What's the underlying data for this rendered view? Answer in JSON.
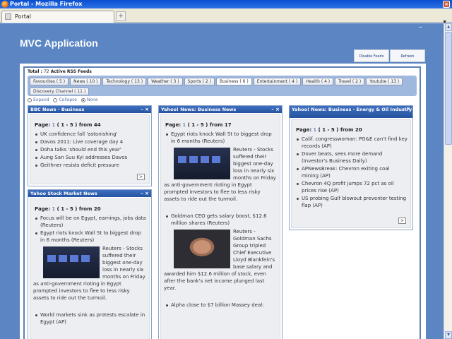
{
  "window": {
    "title": "Portal - Mozilla Firefox",
    "close": "×"
  },
  "browser": {
    "tab_title": "Portal",
    "newtab": "+",
    "scroll_arrow": "▼"
  },
  "app": {
    "title": "MVC Application",
    "dash": "–"
  },
  "actions": {
    "disable_feeds": "Disable Feeds",
    "refresh": "Refresh"
  },
  "total": {
    "label": "Total :",
    "count": "72",
    "suffix": "Active RSS Feeds"
  },
  "categories": [
    "Favourites ( 5 )",
    "News ( 10 )",
    "Technology ( 13 )",
    "Weather ( 3 )",
    "Sports ( 2 )",
    "Business ( 6 )",
    "Entertainment ( 4 )",
    "Health ( 4 )",
    "Travel ( 2 )",
    "Youtube ( 13 )",
    "Discovery Channel ( 11 )"
  ],
  "active_category_index": 5,
  "view_options": {
    "expand": "Expand",
    "collapse": "Collapse",
    "none": "None",
    "selected": "None"
  },
  "widgets": {
    "bbc": {
      "title": "BBC News - Business",
      "ctrls": "– ×",
      "pager": {
        "label": "Page:",
        "page": "1",
        "range": "( 1 - 5 )",
        "from": "from 44"
      },
      "items": [
        "UK confidence fall 'astonishing'",
        "Davos 2011: Live coverage day 4",
        "Doha talks 'should end this year'",
        "Aung San Suu Kyi addresses Davos",
        "Geithner resists deficit pressure"
      ],
      "more": ">"
    },
    "stock": {
      "title": "Yahoo Stock Market News",
      "ctrls": "– ×",
      "pager": {
        "label": "Page:",
        "page": "1",
        "range": "( 1 - 5 )",
        "from": "from 20"
      },
      "items": [
        "Focus will be on Egypt, earnings, jobs data (Reuters)",
        "Egypt riots knock Wall St to biggest drop in 6 months (Reuters)"
      ],
      "story_text": "Reuters - Stocks suffered their biggest one-day loss in nearly six months on Friday as anti-government rioting in Egypt prompted investors to flee to less risky assets to ride out the turmoil.",
      "last_item": "World markets sink as protests escalate in Egypt (AP)"
    },
    "yahoo_business": {
      "title": "Yahoo! News: Business News",
      "ctrls": "– ×",
      "pager": {
        "label": "Page:",
        "page": "1",
        "range": "( 1 - 5 )",
        "from": "from 17"
      },
      "item1": "Egypt riots knock Wall St to biggest drop in 6 months (Reuters)",
      "story1": "Reuters - Stocks suffered their biggest one-day loss in nearly six months on Friday as anti-government rioting in Egypt prompted investors to flee to less risky assets to ride out the turmoil.",
      "item2": "Goldman CEO gets salary boost, $12.6 million shares (Reuters)",
      "story2": "Reuters - Goldman Sachs Group tripled Chief Executive Lloyd Blankfein's base salary and awarded him $12.6 million of stock, even after the bank's net income plunged last year.",
      "item3": "Alpha close to $7 billion Massey deal:"
    },
    "energy": {
      "title": "Yahoo! News: Business - Energy & Oil Industry",
      "ctrls": "– ×",
      "pager": {
        "label": "Page:",
        "page": "1",
        "range": "( 1 - 5 )",
        "from": "from 20"
      },
      "items": [
        "Calif. congresswoman: PG&E can't find key records (AP)",
        "Dover beats, sees more demand (Investor's Business Daily)",
        "APNewsBreak: Chevron exiting coal mining (AP)",
        "Chevron 4Q profit jumps 72 pct as oil prices rise (AP)",
        "US probing Gulf blowout preventer testing flap (AP)"
      ],
      "more": ">"
    }
  },
  "scrollbar": {
    "up": "▲",
    "down": "▼"
  }
}
